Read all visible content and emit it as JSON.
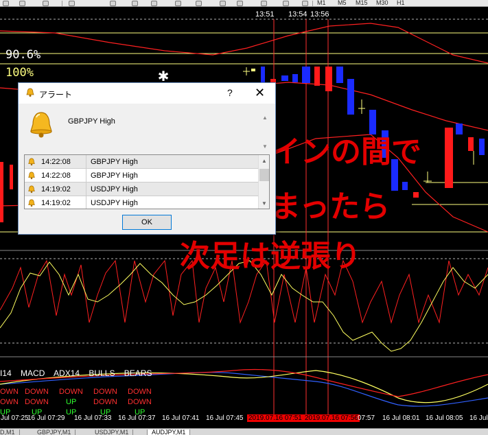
{
  "chart": {
    "time_marks": [
      "13:51",
      "13:54",
      "13:56"
    ],
    "percent_top": "90.6%",
    "percent_bottom": "100%",
    "colors": {
      "bull": "#1a2bff",
      "bear": "#ff1a1a",
      "band": "#ff2020",
      "level": "#ffff80",
      "osc_fast": "#ff2020",
      "osc_slow": "#ffff60",
      "macd_blue": "#3060ff"
    }
  },
  "toolbar": {
    "labels": [
      "M1",
      "M5",
      "M15",
      "M30",
      "H1"
    ]
  },
  "indicators": {
    "header": [
      "I14",
      "MACD",
      "ADX14",
      "BULLS",
      "BEARS"
    ],
    "rows": [
      [
        "OWN",
        "DOWN",
        "DOWN",
        "DOWN",
        "DOWN"
      ],
      [
        "OWN",
        "DOWN",
        "UP",
        "DOWN",
        "DOWN"
      ],
      [
        "UP",
        "UP",
        "UP",
        "UP",
        "UP"
      ]
    ]
  },
  "time_axis": {
    "labels": [
      "l Jul 07:25",
      "16 Jul 07:29",
      "16 Jul 07:33",
      "16 Jul 07:37",
      "16 Jul 07:41",
      "16 Jul 07:45",
      "2019.07.16 07:51",
      "2019.07.16 07:56",
      "07:57",
      "16 Jul 08:01",
      "16 Jul 08:05",
      "16 Jul 08:09"
    ]
  },
  "tabs": [
    "D,M1",
    "GBPJPY,M1",
    "USDJPY,M1",
    "AUDJPY,M1"
  ],
  "overlay": {
    "lines": [
      "自動ラインの間で",
      "足が止まったら",
      "次足は逆張り"
    ]
  },
  "dialog": {
    "title": "アラート",
    "help": "?",
    "close": "✕",
    "message": "GBPJPY High",
    "alerts": [
      {
        "time": "14:22:08",
        "msg": "GBPJPY High"
      },
      {
        "time": "14:22:08",
        "msg": "GBPJPY High"
      },
      {
        "time": "14:19:02",
        "msg": "USDJPY High"
      },
      {
        "time": "14:19:02",
        "msg": "USDJPY High"
      }
    ],
    "ok_label": "OK"
  }
}
